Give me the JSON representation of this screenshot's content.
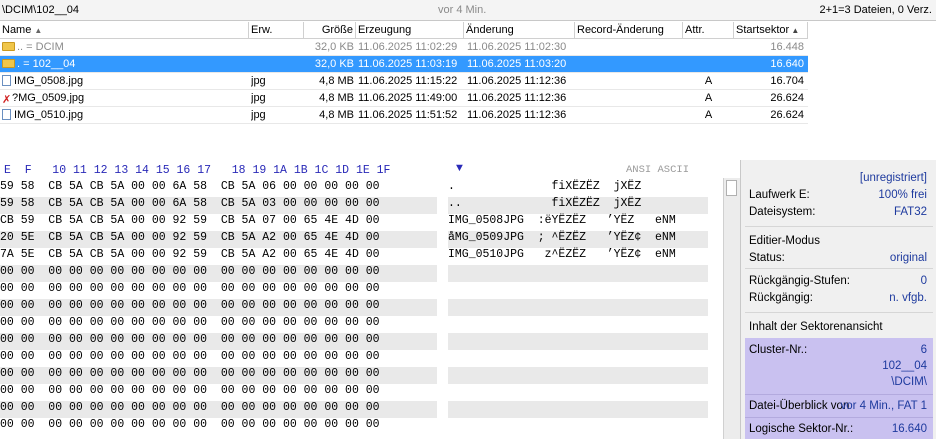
{
  "pathbar": {
    "path": "\\DCIM\\102__04",
    "time_ago": "vor 4 Min.",
    "file_count": "2+1=3 Dateien, 0 Verz."
  },
  "filelist": {
    "columns": [
      "Name",
      "Erw.",
      "Größe",
      "Erzeugung",
      "Änderung",
      "Record-Änderung",
      "Attr.",
      "Startsektor"
    ],
    "rows": [
      {
        "icon": "folder-icon",
        "name": "..  = DCIM",
        "ext": "",
        "size": "32,0 KB",
        "created": "11.06.2025  11:02:29",
        "modified": "11.06.2025  11:02:30",
        "record": "",
        "attr": "",
        "sector": "16.448",
        "state": "dim"
      },
      {
        "icon": "folder-icon",
        "name": ".  = 102__04",
        "ext": "",
        "size": "32,0 KB",
        "created": "11.06.2025  11:03:19",
        "modified": "11.06.2025  11:03:20",
        "record": "",
        "attr": "",
        "sector": "16.640",
        "state": "selected"
      },
      {
        "icon": "file-icon",
        "name": "IMG_0508.jpg",
        "ext": "jpg",
        "size": "4,8 MB",
        "created": "11.06.2025  11:15:22",
        "modified": "11.06.2025  11:12:36",
        "record": "",
        "attr": "A",
        "sector": "16.704",
        "state": "normal"
      },
      {
        "icon": "deleted-file-icon",
        "name": "?MG_0509.jpg",
        "ext": "jpg",
        "size": "4,8 MB",
        "created": "11.06.2025  11:49:00",
        "modified": "11.06.2025  11:12:36",
        "record": "",
        "attr": "A",
        "sector": "26.624",
        "state": "normal"
      },
      {
        "icon": "file-icon",
        "name": "IMG_0510.jpg",
        "ext": "jpg",
        "size": "4,8 MB",
        "created": "11.06.2025  11:51:52",
        "modified": "11.06.2025  11:12:36",
        "record": "",
        "attr": "A",
        "sector": "26.624",
        "state": "normal"
      }
    ]
  },
  "hex": {
    "header": "E  F   10 11 12 13 14 15 16 17   18 19 1A 1B 1C 1D 1E 1F",
    "ascii_header": "ANSI ASCII",
    "rows": [
      "59 58  CB 5A CB 5A 00 00 6A 58  CB 5A 06 00 00 00 00 00",
      "59 58  CB 5A CB 5A 00 00 6A 58  CB 5A 03 00 00 00 00 00",
      "CB 59  CB 5A CB 5A 00 00 92 59  CB 5A 07 00 65 4E 4D 00",
      "20 5E  CB 5A CB 5A 00 00 92 59  CB 5A A2 00 65 4E 4D 00",
      "7A 5E  CB 5A CB 5A 00 00 92 59  CB 5A A2 00 65 4E 4D 00",
      "00 00  00 00 00 00 00 00 00 00  00 00 00 00 00 00 00 00",
      "00 00  00 00 00 00 00 00 00 00  00 00 00 00 00 00 00 00",
      "00 00  00 00 00 00 00 00 00 00  00 00 00 00 00 00 00 00",
      "00 00  00 00 00 00 00 00 00 00  00 00 00 00 00 00 00 00",
      "00 00  00 00 00 00 00 00 00 00  00 00 00 00 00 00 00 00",
      "00 00  00 00 00 00 00 00 00 00  00 00 00 00 00 00 00 00",
      "00 00  00 00 00 00 00 00 00 00  00 00 00 00 00 00 00 00",
      "00 00  00 00 00 00 00 00 00 00  00 00 00 00 00 00 00 00",
      "00 00  00 00 00 00 00 00 00 00  00 00 00 00 00 00 00 00",
      "00 00  00 00 00 00 00 00 00 00  00 00 00 00 00 00 00 00"
    ],
    "ascii_rows": [
      ".              fiXËZËZ  jXËZ",
      "..             fiXËZËZ  jXËZ",
      "IMG_0508JPG  :ëYËZËZ   ’YËZ   eNM",
      "åMG_0509JPG  ; ^ËZËZ   ’YËZ¢  eNM",
      "IMG_0510JPG   z^ËZËZ   ’YËZ¢  eNM",
      "",
      "",
      "",
      "",
      "",
      "",
      "",
      "",
      "",
      ""
    ]
  },
  "info": {
    "registration": "[unregistriert]",
    "drive_label": "Laufwerk E:",
    "drive_value": "100% frei",
    "fs_label": "Dateisystem:",
    "fs_value": "FAT32",
    "edit_mode_title": "Editier-Modus",
    "status_label": "Status:",
    "status_value": "original",
    "undo_levels_label": "Rückgängig-Stufen:",
    "undo_levels_value": "0",
    "undo_label": "Rückgängig:",
    "undo_value": "n. vfgb.",
    "sector_view_title": "Inhalt der Sektorenansicht",
    "cluster_label": "Cluster-Nr.:",
    "cluster_value": "6",
    "cluster_dir": "102__04",
    "cluster_parent": "\\DCIM\\",
    "overview_label": "Datei-Überblick von",
    "overview_value": "vor 4 Min., FAT 1",
    "logical_label": "Logische Sektor-Nr.:",
    "logical_value": "16.640"
  },
  "colors": {
    "selection": "#3399ff",
    "hex_header": "#2a2ab8",
    "info_value": "#1e3a9e",
    "purple_panel": "#c9c1f0"
  }
}
